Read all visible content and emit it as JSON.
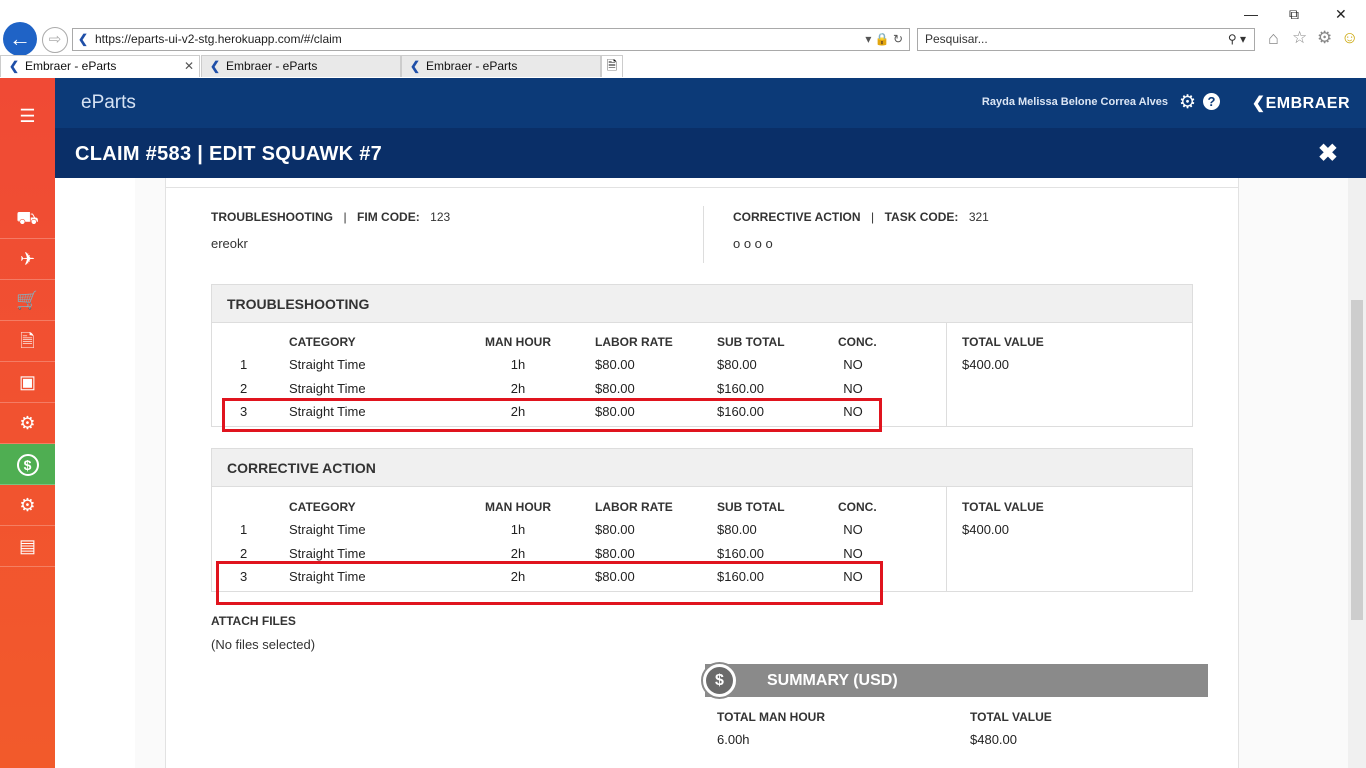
{
  "browser": {
    "url_prefix": "https://",
    "url_domain": "eparts-ui-v2-stg.herokuapp.com",
    "url_path": "/#/claim",
    "search_placeholder": "Pesquisar...",
    "tabs": [
      {
        "label": "Embraer - eParts",
        "active": true
      },
      {
        "label": "Embraer - eParts",
        "active": false
      },
      {
        "label": "Embraer - eParts",
        "active": false
      }
    ]
  },
  "app": {
    "name": "eParts",
    "user": "Rayda Melissa Belone Correa Alves",
    "brand": "EMBRAER",
    "accent_color": "#0c3a78",
    "sidebar_color": "#f04a35"
  },
  "sidebar": {
    "items": [
      {
        "icon": "menu-icon"
      },
      {
        "icon": "truck-icon"
      },
      {
        "icon": "airplane-icon"
      },
      {
        "icon": "cart-icon"
      },
      {
        "icon": "document-icon"
      },
      {
        "icon": "package-return-icon"
      },
      {
        "icon": "gears-exchange-icon"
      },
      {
        "icon": "dollar-icon",
        "active": true
      },
      {
        "icon": "settings-icon"
      },
      {
        "icon": "bar-chart-icon"
      }
    ]
  },
  "modal": {
    "title": "CLAIM #583 | EDIT SQUAWK #7"
  },
  "header": {
    "troubleshooting_label": "TROUBLESHOOTING",
    "sep": "|",
    "fim_label": "FIM CODE:",
    "fim_value": "123",
    "troubleshooting_text": "ereokr",
    "corrective_label": "CORRECTIVE ACTION",
    "task_label": "TASK CODE:",
    "task_value": "321",
    "corrective_text": "o o o o"
  },
  "columns": {
    "category": "CATEGORY",
    "man_hour": "MAN HOUR",
    "labor_rate": "LABOR RATE",
    "sub_total": "SUB TOTAL",
    "conc": "CONC.",
    "total_value": "TOTAL VALUE"
  },
  "troubleshooting": {
    "title": "TROUBLESHOOTING",
    "total": "$400.00",
    "rows": [
      {
        "n": "1",
        "category": "Straight Time",
        "man_hour": "1h",
        "labor_rate": "$80.00",
        "sub_total": "$80.00",
        "conc": "NO"
      },
      {
        "n": "2",
        "category": "Straight Time",
        "man_hour": "2h",
        "labor_rate": "$80.00",
        "sub_total": "$160.00",
        "conc": "NO"
      },
      {
        "n": "3",
        "category": "Straight Time",
        "man_hour": "2h",
        "labor_rate": "$80.00",
        "sub_total": "$160.00",
        "conc": "NO"
      }
    ]
  },
  "corrective": {
    "title": "CORRECTIVE ACTION",
    "total": "$400.00",
    "rows": [
      {
        "n": "1",
        "category": "Straight Time",
        "man_hour": "1h",
        "labor_rate": "$80.00",
        "sub_total": "$80.00",
        "conc": "NO"
      },
      {
        "n": "2",
        "category": "Straight Time",
        "man_hour": "2h",
        "labor_rate": "$80.00",
        "sub_total": "$160.00",
        "conc": "NO"
      },
      {
        "n": "3",
        "category": "Straight Time",
        "man_hour": "2h",
        "labor_rate": "$80.00",
        "sub_total": "$160.00",
        "conc": "NO"
      }
    ]
  },
  "attach": {
    "label": "ATTACH FILES",
    "status": "(No files selected)"
  },
  "summary": {
    "title": "SUMMARY (USD)",
    "man_hour_label": "TOTAL MAN HOUR",
    "man_hour_value": "6.00h",
    "total_label": "TOTAL VALUE",
    "total_value": "$480.00"
  }
}
